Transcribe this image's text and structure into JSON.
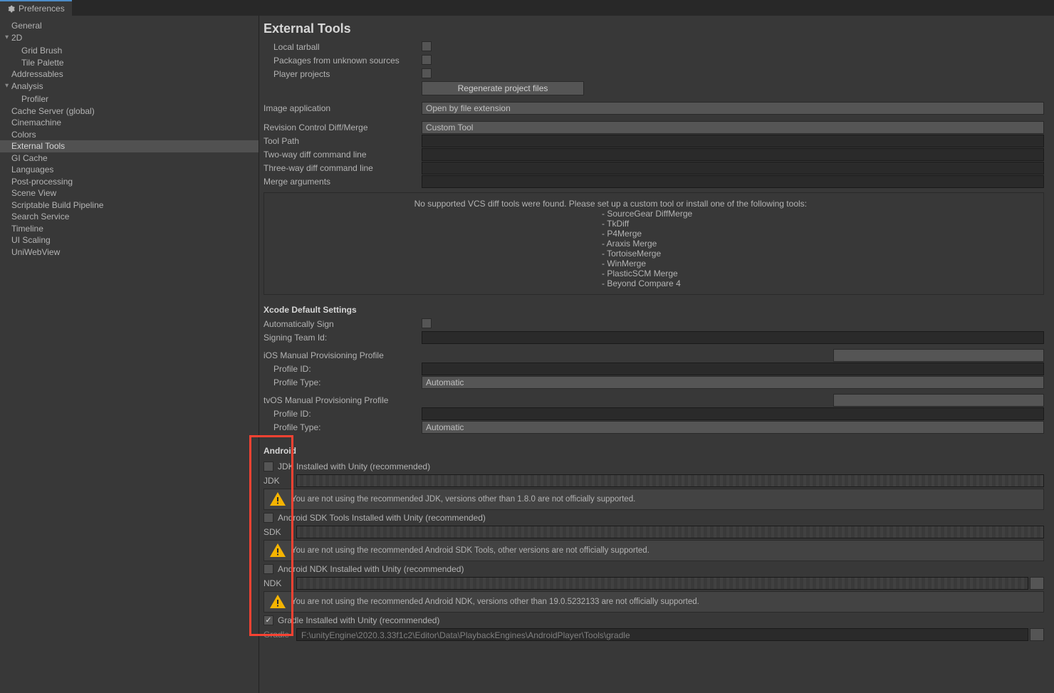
{
  "tab_title": "Preferences",
  "sidebar": {
    "items": [
      {
        "label": "General",
        "level": 0
      },
      {
        "label": "2D",
        "level": 0,
        "foldout": true
      },
      {
        "label": "Grid Brush",
        "level": 1
      },
      {
        "label": "Tile Palette",
        "level": 1
      },
      {
        "label": "Addressables",
        "level": 0
      },
      {
        "label": "Analysis",
        "level": 0,
        "foldout": true
      },
      {
        "label": "Profiler",
        "level": 1
      },
      {
        "label": "Cache Server (global)",
        "level": 0
      },
      {
        "label": "Cinemachine",
        "level": 0
      },
      {
        "label": "Colors",
        "level": 0
      },
      {
        "label": "External Tools",
        "level": 0,
        "selected": true
      },
      {
        "label": "GI Cache",
        "level": 0
      },
      {
        "label": "Languages",
        "level": 0
      },
      {
        "label": "Post-processing",
        "level": 0
      },
      {
        "label": "Scene View",
        "level": 0
      },
      {
        "label": "Scriptable Build Pipeline",
        "level": 0
      },
      {
        "label": "Search Service",
        "level": 0
      },
      {
        "label": "Timeline",
        "level": 0
      },
      {
        "label": "UI Scaling",
        "level": 0
      },
      {
        "label": "UniWebView",
        "level": 0
      }
    ]
  },
  "main": {
    "title": "External Tools",
    "local_tarball": "Local tarball",
    "packages_unknown": "Packages from unknown sources",
    "player_projects": "Player projects",
    "regen_btn": "Regenerate project files",
    "image_app": {
      "label": "Image application",
      "value": "Open by file extension"
    },
    "rev_control": {
      "label": "Revision Control Diff/Merge",
      "value": "Custom Tool"
    },
    "tool_path": "Tool Path",
    "two_way": "Two-way diff command line",
    "three_way": "Three-way diff command line",
    "merge_args": "Merge arguments",
    "vcs_msg": "No supported VCS diff tools were found. Please set up a custom tool or install one of the following tools:",
    "vcs_tools": [
      "SourceGear DiffMerge",
      "TkDiff",
      "P4Merge",
      "Araxis Merge",
      "TortoiseMerge",
      "WinMerge",
      "PlasticSCM Merge",
      "Beyond Compare 4"
    ],
    "xcode_header": "Xcode Default Settings",
    "auto_sign": "Automatically Sign",
    "signing_team": "Signing Team Id:",
    "ios_prov": "iOS Manual Provisioning Profile",
    "tvos_prov": "tvOS Manual Provisioning Profile",
    "profile_id": "Profile ID:",
    "profile_type": {
      "label": "Profile Type:",
      "value": "Automatic"
    },
    "android_header": "Android",
    "jdk_cb": "JDK Installed with Unity (recommended)",
    "jdk_label": "JDK",
    "jdk_warn": "You are not using the recommended JDK, versions other than 1.8.0 are not officially supported.",
    "sdk_cb": "Android SDK Tools Installed with Unity (recommended)",
    "sdk_label": "SDK",
    "sdk_warn": "You are not using the recommended Android SDK Tools, other versions are not officially supported.",
    "ndk_cb": "Android NDK Installed with Unity (recommended)",
    "ndk_label": "NDK",
    "ndk_warn": "You are not using the recommended Android NDK, versions other than 19.0.5232133 are not officially supported.",
    "gradle_cb": "Gradle Installed with Unity (recommended)",
    "gradle_label": "Gradle",
    "gradle_path": "F:\\unityEngine\\2020.3.33f1c2\\Editor\\Data\\PlaybackEngines\\AndroidPlayer\\Tools\\gradle"
  }
}
